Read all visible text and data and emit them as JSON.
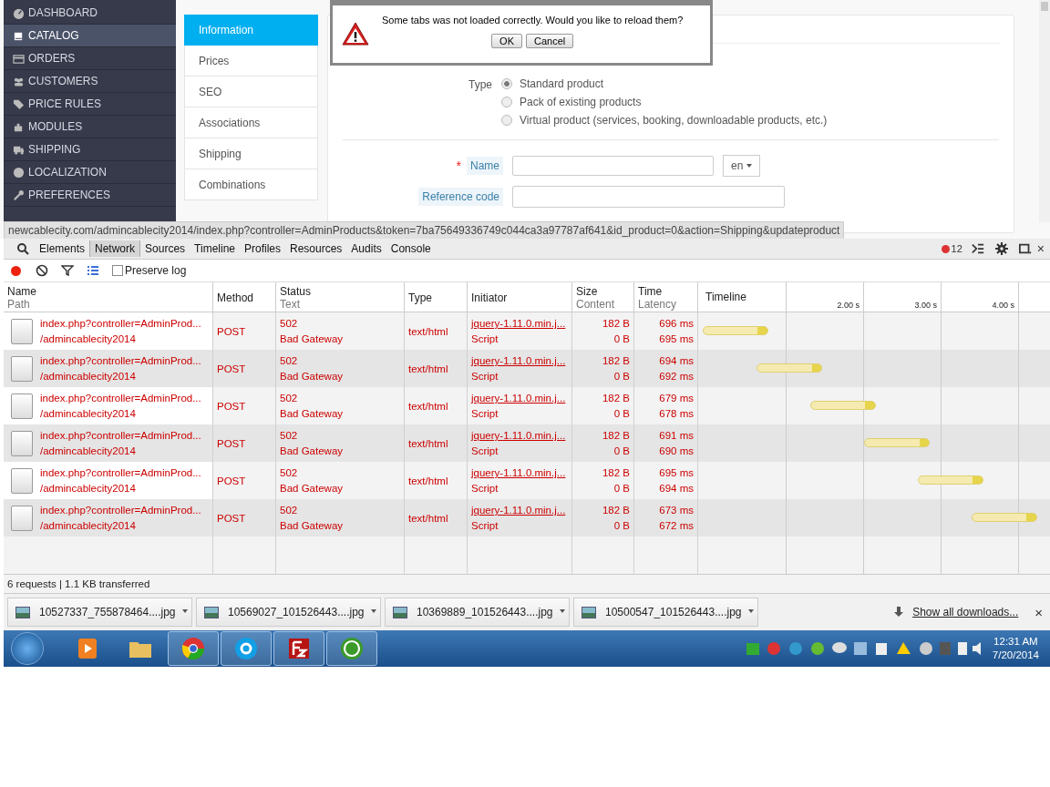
{
  "sidebar": {
    "items": [
      {
        "label": "DASHBOARD",
        "selected": false
      },
      {
        "label": "CATALOG",
        "selected": true
      },
      {
        "label": "ORDERS",
        "selected": false
      },
      {
        "label": "CUSTOMERS",
        "selected": false
      },
      {
        "label": "PRICE RULES",
        "selected": false
      },
      {
        "label": "MODULES",
        "selected": false
      },
      {
        "label": "SHIPPING",
        "selected": false
      },
      {
        "label": "LOCALIZATION",
        "selected": false
      },
      {
        "label": "PREFERENCES",
        "selected": false
      }
    ]
  },
  "product_tabs": [
    {
      "label": "Information",
      "selected": true
    },
    {
      "label": "Prices",
      "selected": false
    },
    {
      "label": "SEO",
      "selected": false
    },
    {
      "label": "Associations",
      "selected": false
    },
    {
      "label": "Shipping",
      "selected": false
    },
    {
      "label": "Combinations",
      "selected": false
    }
  ],
  "form": {
    "type_label": "Type",
    "types": [
      {
        "label": "Standard product",
        "selected": true
      },
      {
        "label": "Pack of existing products",
        "selected": false
      },
      {
        "label": "Virtual product (services, booking, downloadable products, etc.)",
        "selected": false
      }
    ],
    "required_mark": "*",
    "name_label": "Name",
    "language": "en",
    "reference_label": "Reference code"
  },
  "dialog": {
    "message": "Some tabs was not loaded correctly. Would you like to reload them?",
    "buttons": [
      "OK",
      "Cancel"
    ]
  },
  "status_url": "newcablecity.com/admincablecity2014/index.php?controller=AdminProducts&token=7ba75649336749c044ca3a97787af641&id_product=0&action=Shipping&updateproduct",
  "devtools": {
    "tabs": [
      {
        "label": "Elements",
        "selected": false
      },
      {
        "label": "Network",
        "selected": true
      },
      {
        "label": "Sources",
        "selected": false
      },
      {
        "label": "Timeline",
        "selected": false
      },
      {
        "label": "Profiles",
        "selected": false
      },
      {
        "label": "Resources",
        "selected": false
      },
      {
        "label": "Audits",
        "selected": false
      },
      {
        "label": "Console",
        "selected": false
      }
    ],
    "error_count": "12",
    "close": "×",
    "preserve_log": {
      "label": "Preserve log",
      "checked": false
    },
    "columns": [
      {
        "title": "Name",
        "subtitle": "Path"
      },
      {
        "title": "Method"
      },
      {
        "title": "Status",
        "subtitle": "Text"
      },
      {
        "title": "Type"
      },
      {
        "title": "Initiator"
      },
      {
        "title": "Size",
        "subtitle": "Content"
      },
      {
        "title": "Time",
        "subtitle": "Latency"
      },
      {
        "title": "Timeline"
      }
    ],
    "timeline_ticks": [
      "2.00 s",
      "3.00 s",
      "4.00 s"
    ],
    "rows": [
      {
        "name": "index.php?controller=AdminProd...",
        "path": "/admincablecity2014",
        "method": "POST",
        "status": "502",
        "status_text": "Bad Gateway",
        "type": "text/html",
        "initiator": "jquery-1.11.0.min.j...",
        "initiator_type": "Script",
        "size": "182 B",
        "content": "0 B",
        "time": "696 ms",
        "latency": "695 ms"
      },
      {
        "name": "index.php?controller=AdminProd...",
        "path": "/admincablecity2014",
        "method": "POST",
        "status": "502",
        "status_text": "Bad Gateway",
        "type": "text/html",
        "initiator": "jquery-1.11.0.min.j...",
        "initiator_type": "Script",
        "size": "182 B",
        "content": "0 B",
        "time": "694 ms",
        "latency": "692 ms"
      },
      {
        "name": "index.php?controller=AdminProd...",
        "path": "/admincablecity2014",
        "method": "POST",
        "status": "502",
        "status_text": "Bad Gateway",
        "type": "text/html",
        "initiator": "jquery-1.11.0.min.j...",
        "initiator_type": "Script",
        "size": "182 B",
        "content": "0 B",
        "time": "679 ms",
        "latency": "678 ms"
      },
      {
        "name": "index.php?controller=AdminProd...",
        "path": "/admincablecity2014",
        "method": "POST",
        "status": "502",
        "status_text": "Bad Gateway",
        "type": "text/html",
        "initiator": "jquery-1.11.0.min.j...",
        "initiator_type": "Script",
        "size": "182 B",
        "content": "0 B",
        "time": "691 ms",
        "latency": "690 ms"
      },
      {
        "name": "index.php?controller=AdminProd...",
        "path": "/admincablecity2014",
        "method": "POST",
        "status": "502",
        "status_text": "Bad Gateway",
        "type": "text/html",
        "initiator": "jquery-1.11.0.min.j...",
        "initiator_type": "Script",
        "size": "182 B",
        "content": "0 B",
        "time": "695 ms",
        "latency": "694 ms"
      },
      {
        "name": "index.php?controller=AdminProd...",
        "path": "/admincablecity2014",
        "method": "POST",
        "status": "502",
        "status_text": "Bad Gateway",
        "type": "text/html",
        "initiator": "jquery-1.11.0.min.j...",
        "initiator_type": "Script",
        "size": "182 B",
        "content": "0 B",
        "time": "673 ms",
        "latency": "672 ms"
      }
    ],
    "summary": "6 requests | 1.1 KB transferred"
  },
  "downloads": {
    "items": [
      "10527337_755878464....jpg",
      "10569027_101526443....jpg",
      "10369889_101526443....jpg",
      "10500547_101526443....jpg"
    ],
    "show_all": "Show all downloads...",
    "close": "×"
  },
  "taskbar": {
    "apps": [
      {
        "running": false
      },
      {
        "running": false
      },
      {
        "running": true
      },
      {
        "running": true
      },
      {
        "running": true
      },
      {
        "running": true
      }
    ],
    "time": "12:31 AM",
    "date": "7/20/2014"
  }
}
